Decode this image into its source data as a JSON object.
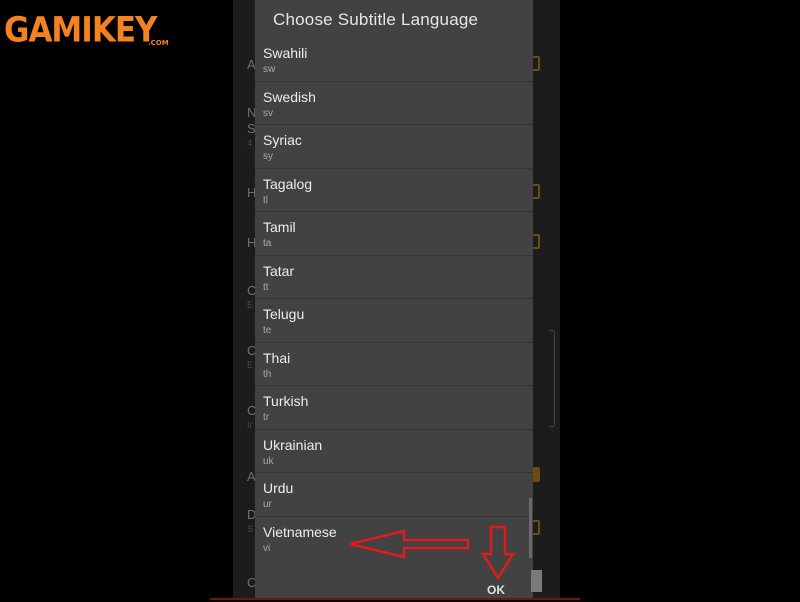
{
  "logo": {
    "text": "GAMIKEY",
    "suffix": ".COM"
  },
  "background": {
    "rows": [
      {
        "letter": "A",
        "sub": ""
      },
      {
        "letter": "N",
        "sub": ""
      },
      {
        "letter": "S",
        "sub": "4"
      },
      {
        "letter": "H",
        "sub": ""
      },
      {
        "letter": "H",
        "sub": ""
      },
      {
        "letter": "C",
        "sub": "E"
      },
      {
        "letter": "C",
        "sub": "E"
      },
      {
        "letter": "C",
        "sub": "Ir"
      },
      {
        "letter": "A",
        "sub": ""
      },
      {
        "letter": "D",
        "sub": "S"
      },
      {
        "letter": "C",
        "sub": ""
      }
    ]
  },
  "dialog": {
    "title": "Choose Subtitle Language",
    "languages": [
      {
        "name": "Swahili",
        "code": "sw"
      },
      {
        "name": "Swedish",
        "code": "sv"
      },
      {
        "name": "Syriac",
        "code": "sy"
      },
      {
        "name": "Tagalog",
        "code": "tl"
      },
      {
        "name": "Tamil",
        "code": "ta"
      },
      {
        "name": "Tatar",
        "code": "tt"
      },
      {
        "name": "Telugu",
        "code": "te"
      },
      {
        "name": "Thai",
        "code": "th"
      },
      {
        "name": "Turkish",
        "code": "tr"
      },
      {
        "name": "Ukrainian",
        "code": "uk"
      },
      {
        "name": "Urdu",
        "code": "ur"
      },
      {
        "name": "Vietnamese",
        "code": "vi"
      }
    ],
    "ok_label": "OK"
  },
  "colors": {
    "logo_orange": "#f58220",
    "dialog_bg": "#424242",
    "annotation_red": "#e01b1b"
  }
}
